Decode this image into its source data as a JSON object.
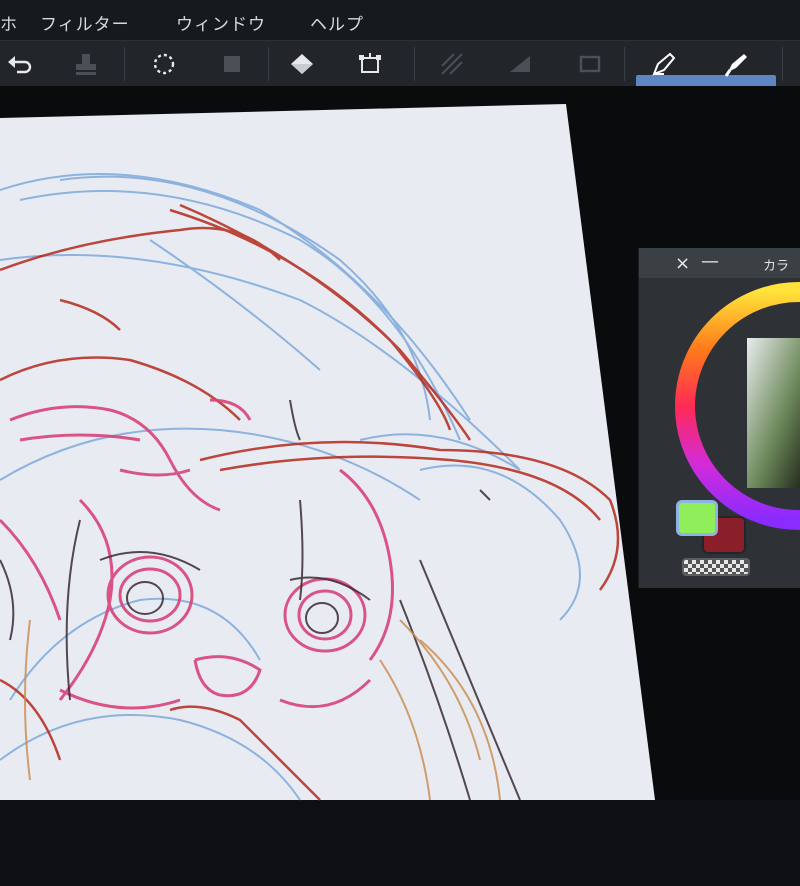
{
  "menu": {
    "items": [
      {
        "label": "ホ"
      },
      {
        "label": "フィルター"
      },
      {
        "label": "ウィンドウ"
      },
      {
        "label": "ヘルプ"
      }
    ]
  },
  "toolbar": {
    "tools": [
      {
        "icon": "undo-icon"
      },
      {
        "icon": "stamp-icon"
      },
      {
        "icon": "lasso-select-icon"
      },
      {
        "icon": "layer-icon"
      },
      {
        "icon": "fill-bucket-icon"
      },
      {
        "icon": "transform-icon"
      },
      {
        "icon": "hatch-icon"
      },
      {
        "icon": "gradient-icon"
      },
      {
        "icon": "frame-icon"
      },
      {
        "icon": "pen-icon",
        "active": true
      },
      {
        "icon": "brush-icon",
        "active": true
      }
    ],
    "active_color": "#5d87c2"
  },
  "color_panel": {
    "title": "カラ",
    "close_glyph": "×",
    "min_glyph": "—",
    "foreground_color": "#90ee5a",
    "background_color": "#8a1f2a"
  },
  "colors": {
    "menubar_bg": "#16191d",
    "toolbar_bg": "#22262b",
    "canvas_paper": "#e8ecf2",
    "sketch_blue": "#6f9fd8",
    "sketch_pink": "#d8437a",
    "sketch_red": "#b5281d",
    "sketch_dark": "#3a2a30",
    "sketch_orange": "#c98a4c"
  }
}
